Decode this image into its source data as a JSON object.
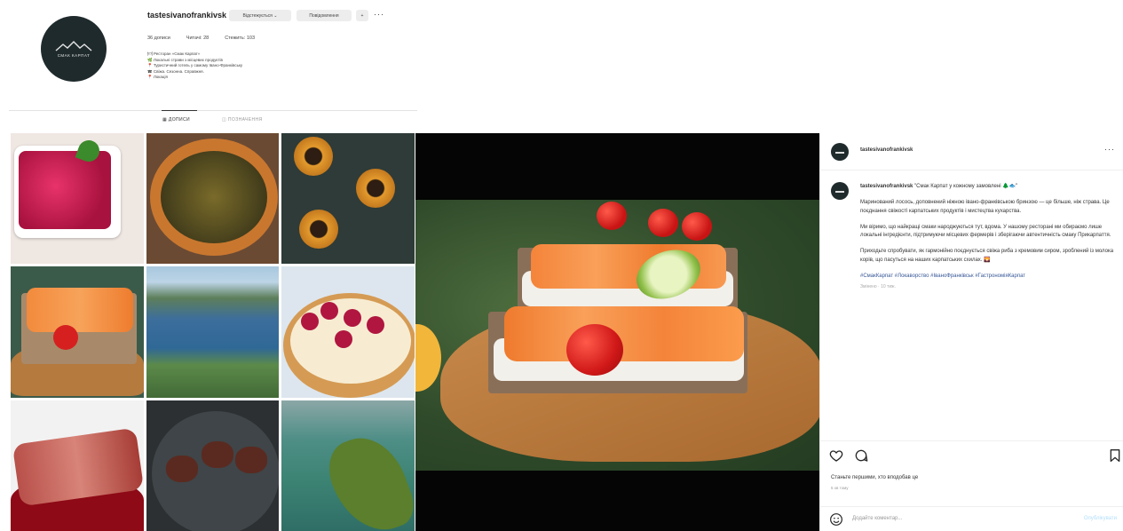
{
  "profile": {
    "username": "tastesivanofrankivsk",
    "avatar_text": "СМАК КАРПАТ",
    "buttons": [
      "Відстежується ⌄",
      "Повідомлення",
      "+"
    ],
    "stats": [
      "36 дописи",
      "Читачі: 28",
      "Стежить: 103"
    ],
    "bio": [
      "🍽 Ресторан «Смак Карпат»",
      "🌿 Локальні страви з місцевих продуктів",
      "📍 Туристичний готель у самому Івано-Франківську",
      "☎ Свіжа. Сезонна. Справжня.",
      "📍 Локація"
    ],
    "tabs": {
      "posts": "▦ ДОПИСИ",
      "tagged": "◫ ПОЗНАЧЕННЯ"
    }
  },
  "post": {
    "username": "tastesivanofrankivsk",
    "caption_user": "tastesivanofrankivsk",
    "caption_title": "\"Смак Карпат у кожному замовлені 🌲🐟\"",
    "paragraphs": [
      "Маринований лосось, доповнений ніжною івано-франківською бринзою — це більше, ніж страва. Це поєднання свіжості карпатських продуктів і мистецтва кухарства.",
      "Ми віримо, що найкращі смаки народжуються тут, вдома. У нашому ресторані ми обираємо лише локальні інгредієнти, підтримуючи місцевих фермерів і зберігаючи автентичність смаку Прикарпаття.",
      "Приходьте спробувати, як гармонійно поєднується свіжа риба з кремовим сиром, зроблений із молока корів, що пасуться на наших карпатських схилах. 🌄"
    ],
    "hashtags": "#СмакКарпат #Локаворство #ІваноФранківськ #ГастрономіяКарпат",
    "caption_time": "Змінено · 10 тиж.",
    "likes_text": "Станьте першими, хто вподобав це",
    "date": "5 хв тому",
    "comment_placeholder": "Додайте коментар...",
    "post_button": "Опублікувати"
  },
  "colors": {
    "avatar_bg": "#1f2a2c",
    "link": "#385898"
  },
  "icons": [
    "heart-icon",
    "comment-icon",
    "bookmark-icon",
    "emoji-icon",
    "more-icon"
  ]
}
